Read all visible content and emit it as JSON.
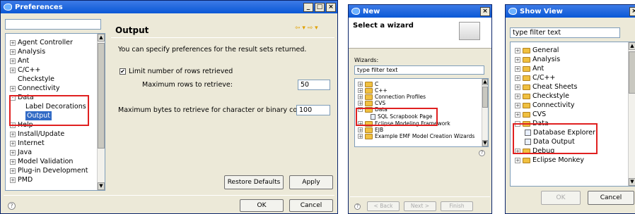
{
  "pref": {
    "title": "Preferences",
    "filter": "",
    "tree": [
      {
        "label": "Agent Controller",
        "expander": "+"
      },
      {
        "label": "Analysis",
        "expander": "+"
      },
      {
        "label": "Ant",
        "expander": "+"
      },
      {
        "label": "C/C++",
        "expander": "+"
      },
      {
        "label": "Checkstyle",
        "expander": ""
      },
      {
        "label": "Connectivity",
        "expander": "+"
      },
      {
        "label": "Data",
        "expander": "-"
      },
      {
        "label": "Label Decorations",
        "expander": ""
      },
      {
        "label": "Output",
        "expander": ""
      },
      {
        "label": "Help",
        "expander": "+"
      },
      {
        "label": "Install/Update",
        "expander": "+"
      },
      {
        "label": "Internet",
        "expander": "+"
      },
      {
        "label": "Java",
        "expander": "+"
      },
      {
        "label": "Model Validation",
        "expander": "+"
      },
      {
        "label": "Plug-in Development",
        "expander": "+"
      },
      {
        "label": "PMD",
        "expander": "+"
      }
    ],
    "heading": "Output",
    "description": "You can specify preferences for the result sets returned.",
    "limit_label": "Limit number of rows retrieved",
    "limit_checked": "✔",
    "max_rows_label": "Maximum rows to retrieve:",
    "max_rows_value": "50",
    "max_bytes_label": "Maximum bytes to retrieve for character or binary column:",
    "max_bytes_value": "100",
    "restore_label": "Restore Defaults",
    "apply_label": "Apply",
    "ok_label": "OK",
    "cancel_label": "Cancel",
    "help": "?"
  },
  "newwiz": {
    "title": "New",
    "heading": "Select a wizard",
    "wizards_label": "Wizards:",
    "filter": "type filter text",
    "tree": [
      {
        "label": "C",
        "expander": "+"
      },
      {
        "label": "C++",
        "expander": "+"
      },
      {
        "label": "Connection Profiles",
        "expander": "+"
      },
      {
        "label": "CVS",
        "expander": "+"
      },
      {
        "label": "Data",
        "expander": "-"
      },
      {
        "label": "SQL Scrapbook Page",
        "expander": ""
      },
      {
        "label": "Eclipse Modeling Framework",
        "expander": "+"
      },
      {
        "label": "EJB",
        "expander": "+"
      },
      {
        "label": "Example EMF Model Creation Wizards",
        "expander": "+"
      }
    ],
    "back_label": "< Back",
    "next_label": "Next >",
    "finish_label": "Finish",
    "help": "?"
  },
  "showview": {
    "title": "Show View",
    "filter": "type filter text",
    "tree": [
      {
        "label": "General",
        "expander": "+"
      },
      {
        "label": "Analysis",
        "expander": "+"
      },
      {
        "label": "Ant",
        "expander": "+"
      },
      {
        "label": "C/C++",
        "expander": "+"
      },
      {
        "label": "Cheat Sheets",
        "expander": "+"
      },
      {
        "label": "Checkstyle",
        "expander": "+"
      },
      {
        "label": "Connectivity",
        "expander": "+"
      },
      {
        "label": "CVS",
        "expander": "+"
      },
      {
        "label": "Data",
        "expander": "-"
      },
      {
        "label": "Database Explorer",
        "expander": ""
      },
      {
        "label": "Data Output",
        "expander": ""
      },
      {
        "label": "Debug",
        "expander": "+"
      },
      {
        "label": "Eclipse Monkey",
        "expander": "+"
      }
    ],
    "ok_label": "OK",
    "cancel_label": "Cancel"
  }
}
